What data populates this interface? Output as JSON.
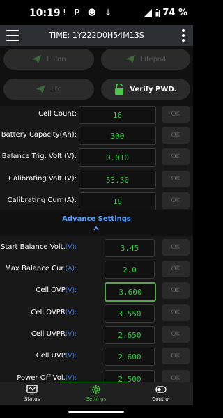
{
  "status_bar": {
    "time": "10:19",
    "icons_left": "! P ☻ ↓",
    "battery": "74 %"
  },
  "app_bar": {
    "title": "TIME: 1Y222D0H54M13S"
  },
  "chemistry": [
    {
      "label": "Li-ion",
      "active": false
    },
    {
      "label": "Lifepo4",
      "active": false
    },
    {
      "label": "Lto",
      "active": false
    }
  ],
  "verify": {
    "label": "Verify PWD."
  },
  "settings": [
    {
      "label": "Cell Count:",
      "unit": "",
      "value": "16",
      "ok": "OK"
    },
    {
      "label": "Battery Capacity(Ah):",
      "unit": "",
      "value": "300",
      "ok": "OK"
    },
    {
      "label": "Balance Trig. Volt.(V):",
      "unit": "",
      "value": "0.010",
      "ok": "OK"
    },
    {
      "label": "Calibrating Volt.(V):",
      "unit": "",
      "value": "53.50",
      "ok": "OK"
    },
    {
      "label": "Calibrating Curr.(A):",
      "unit": "",
      "value": "18",
      "ok": "OK"
    }
  ],
  "advance": {
    "title": "Advance Settings",
    "items": [
      {
        "label": "Start Balance Volt.",
        "unit": "(V):",
        "value": "3.45",
        "ok": "OK"
      },
      {
        "label": "Max Balance Cur.",
        "unit": "(A):",
        "value": "2.0",
        "ok": "OK"
      },
      {
        "label": "Cell OVP",
        "unit": "(V):",
        "value": "3.600",
        "ok": "OK",
        "focused": true
      },
      {
        "label": "Cell OVPR",
        "unit": "(V):",
        "value": "3.550",
        "ok": "OK"
      },
      {
        "label": "Cell UVPR",
        "unit": "(V):",
        "value": "2.650",
        "ok": "OK"
      },
      {
        "label": "Cell UVP",
        "unit": "(V):",
        "value": "2.600",
        "ok": "OK"
      },
      {
        "label": "Power Off Vol.",
        "unit": "(V):",
        "value": "2.500",
        "ok": "OK"
      }
    ]
  },
  "tabs": [
    {
      "label": "Status",
      "icon": "status-icon"
    },
    {
      "label": "Settings",
      "icon": "gear-icon",
      "active": true
    },
    {
      "label": "Control",
      "icon": "toggle-icon"
    }
  ],
  "colors": {
    "accent_green": "#4cc94a",
    "value_green": "#2ecc40",
    "link_blue": "#58a0ff"
  }
}
